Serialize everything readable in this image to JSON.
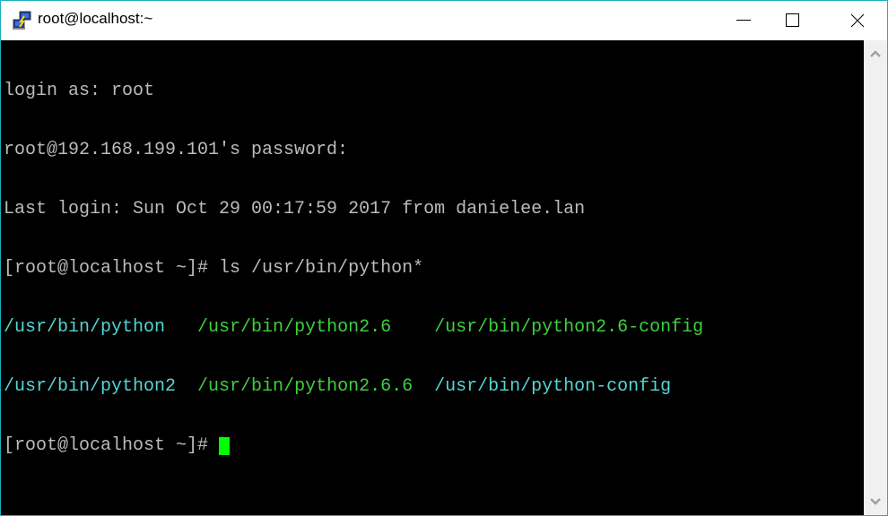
{
  "window": {
    "title": "root@localhost:~",
    "controls": {
      "minimize": "minimize-icon",
      "maximize": "maximize-icon",
      "close": "close-icon"
    },
    "border_color": "#1ab0c0"
  },
  "terminal": {
    "background": "#000000",
    "default_color": "#bbbbbb",
    "lines": [
      {
        "text": "login as: root"
      },
      {
        "text": "root@192.168.199.101's password:"
      },
      {
        "text": "Last login: Sun Oct 29 00:17:59 2017 from danielee.lan"
      },
      {
        "text": "[root@localhost ~]# ls /usr/bin/python*"
      }
    ],
    "ls_output": [
      [
        {
          "text": "/usr/bin/python",
          "color": "cyan"
        },
        {
          "text": "/usr/bin/python2.6",
          "color": "green"
        },
        {
          "text": "/usr/bin/python2.6-config",
          "color": "green"
        }
      ],
      [
        {
          "text": "/usr/bin/python2",
          "color": "cyan"
        },
        {
          "text": "/usr/bin/python2.6.6",
          "color": "green"
        },
        {
          "text": "/usr/bin/python-config",
          "color": "cyan"
        }
      ]
    ],
    "prompt": "[root@localhost ~]# ",
    "cursor_color": "#00ff00",
    "symlink_color": "#55d4d4",
    "executable_color": "#3ecf3e"
  }
}
